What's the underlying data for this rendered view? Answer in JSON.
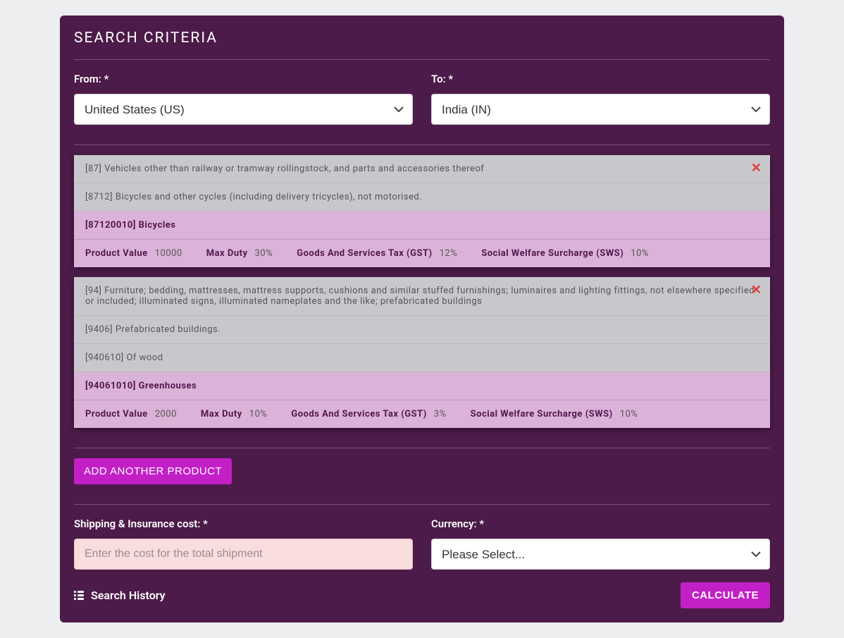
{
  "title": "SEARCH CRITERIA",
  "from": {
    "label": "From: *",
    "value": "United States (US)"
  },
  "to": {
    "label": "To: *",
    "value": "India (IN)"
  },
  "products": [
    {
      "rows": [
        {
          "type": "gray",
          "text": "[87] Vehicles other than railway or tramway rollingstock, and parts and accessories thereof"
        },
        {
          "type": "gray",
          "text": "[8712] Bicycles and other cycles (including delivery tricycles), not motorised."
        },
        {
          "type": "purple",
          "text": "[87120010] Bicycles"
        }
      ],
      "stats": [
        {
          "label": "Product Value",
          "value": "10000"
        },
        {
          "label": "Max Duty",
          "value": "30%"
        },
        {
          "label": "Goods And Services Tax (GST)",
          "value": "12%"
        },
        {
          "label": "Social Welfare Surcharge (SWS)",
          "value": "10%"
        }
      ]
    },
    {
      "rows": [
        {
          "type": "gray",
          "text": "[94] Furniture; bedding, mattresses, mattress supports, cushions and similar stuffed furnishings; luminaires and lighting fittings, not elsewhere specified or included; illuminated signs, illuminated nameplates and the like; prefabricated buildings"
        },
        {
          "type": "gray",
          "text": "[9406] Prefabricated buildings."
        },
        {
          "type": "gray",
          "text": "[940610] Of wood"
        },
        {
          "type": "purple",
          "text": "[94061010] Greenhouses"
        }
      ],
      "stats": [
        {
          "label": "Product Value",
          "value": "2000"
        },
        {
          "label": "Max Duty",
          "value": "10%"
        },
        {
          "label": "Goods And Services Tax (GST)",
          "value": "3%"
        },
        {
          "label": "Social Welfare Surcharge (SWS)",
          "value": "10%"
        }
      ]
    }
  ],
  "add_button": "ADD ANOTHER PRODUCT",
  "shipping": {
    "label": "Shipping & Insurance cost: *",
    "placeholder": "Enter the cost for the total shipment"
  },
  "currency": {
    "label": "Currency: *",
    "value": "Please Select..."
  },
  "history_link": "Search History",
  "calculate_button": "CALCULATE"
}
